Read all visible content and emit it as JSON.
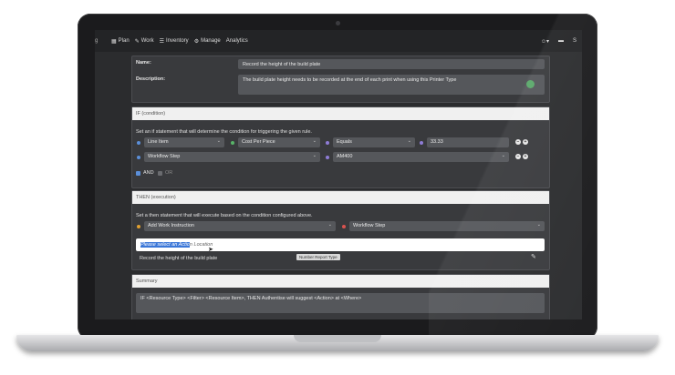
{
  "nav": {
    "logo": "g",
    "items": [
      {
        "icon": "calendar-icon",
        "glyph": "▦",
        "label": "Plan"
      },
      {
        "icon": "wrench-icon",
        "glyph": "✎",
        "label": "Work"
      },
      {
        "icon": "list-icon",
        "glyph": "☰",
        "label": "Inventory"
      },
      {
        "icon": "gear-icon",
        "glyph": "⚙",
        "label": "Manage"
      },
      {
        "icon": "chart-icon",
        "glyph": "",
        "label": "Analytics"
      }
    ],
    "user_glyph": "☺▾",
    "flag_glyph": "▬",
    "extra": "S"
  },
  "rule": {
    "name_label": "Name:",
    "name_value": "Record the height of the build plate",
    "description_label": "Description:",
    "description_value": "The build plate height needs to be recorded at the end of each print when using this Printer Type"
  },
  "if_section": {
    "title": "IF (condition)",
    "instruction": "Set an if statement that will determine the condition for triggering the given rule.",
    "row1": {
      "type": "Line Item",
      "field": "Cost Per Piece",
      "operator": "Equals",
      "value": "33.33"
    },
    "row2": {
      "type": "Workflow Step",
      "value": "AM400"
    },
    "and_label": "AND",
    "or_label": "OR"
  },
  "then_section": {
    "title": "THEN (execution)",
    "instruction": "Set a then statement that will execute based on the condition configured above.",
    "action": "Add Work Instruction",
    "location": "Workflow Step",
    "placeholder_highlight": "Please select an Actio",
    "placeholder_rest": "n Location",
    "record_text": "Record the height of the build plate",
    "badge": "Number Report Type"
  },
  "summary": {
    "title": "Summary",
    "text": "IF <Resource Type> <Filter> <Resource Item>, THEN Authentise will suggest <Action> at <Where>"
  },
  "colors": {
    "blue_dot": "#5b8fd9",
    "green_dot": "#58b368",
    "purple_dot": "#8e7cd6",
    "orange_dot": "#e0a030",
    "red_dot": "#d9534f"
  }
}
